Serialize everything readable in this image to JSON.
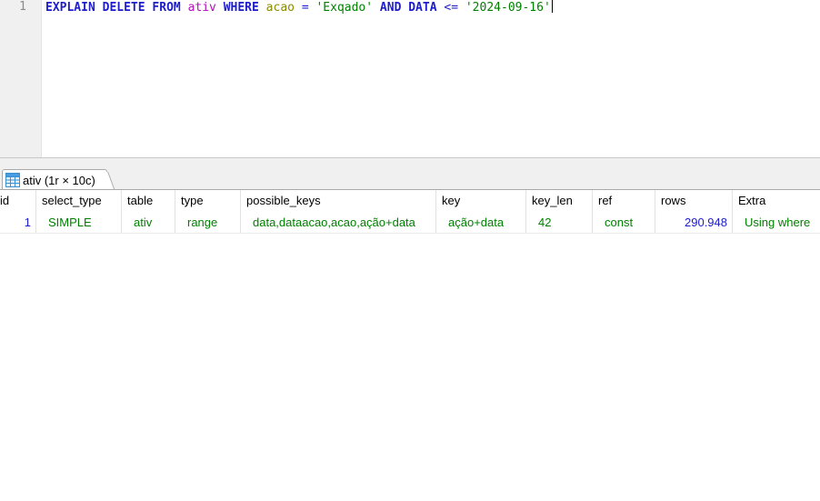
{
  "editor": {
    "line_number": "1",
    "tokens": {
      "explain": "EXPLAIN",
      "delete": "DELETE",
      "from": "FROM",
      "table": "ativ",
      "where": "WHERE",
      "col_acao": "acao",
      "eq": "=",
      "val_acao": "'Exqado'",
      "and": "AND",
      "col_data": "DATA",
      "lte": "<=",
      "val_data": "'2024-09-16'"
    }
  },
  "results_tab": {
    "label": "ativ (1r × 10c)",
    "icon": "table-grid-icon"
  },
  "grid": {
    "columns": [
      "id",
      "select_type",
      "table",
      "type",
      "possible_keys",
      "key",
      "key_len",
      "ref",
      "rows",
      "Extra"
    ],
    "rows": [
      [
        "1",
        "SIMPLE",
        "ativ",
        "range",
        "data,dataacao,acao,ação+data",
        "ação+data",
        "42",
        "const",
        "290.948",
        "Using where"
      ]
    ]
  },
  "colors": {
    "keyword": "#1d1dcc",
    "table_name": "#b20fb8",
    "column_name": "#8a8a00",
    "string_literal": "#008000",
    "grid_number": "#1d1dcc",
    "grid_text": "#008000"
  }
}
